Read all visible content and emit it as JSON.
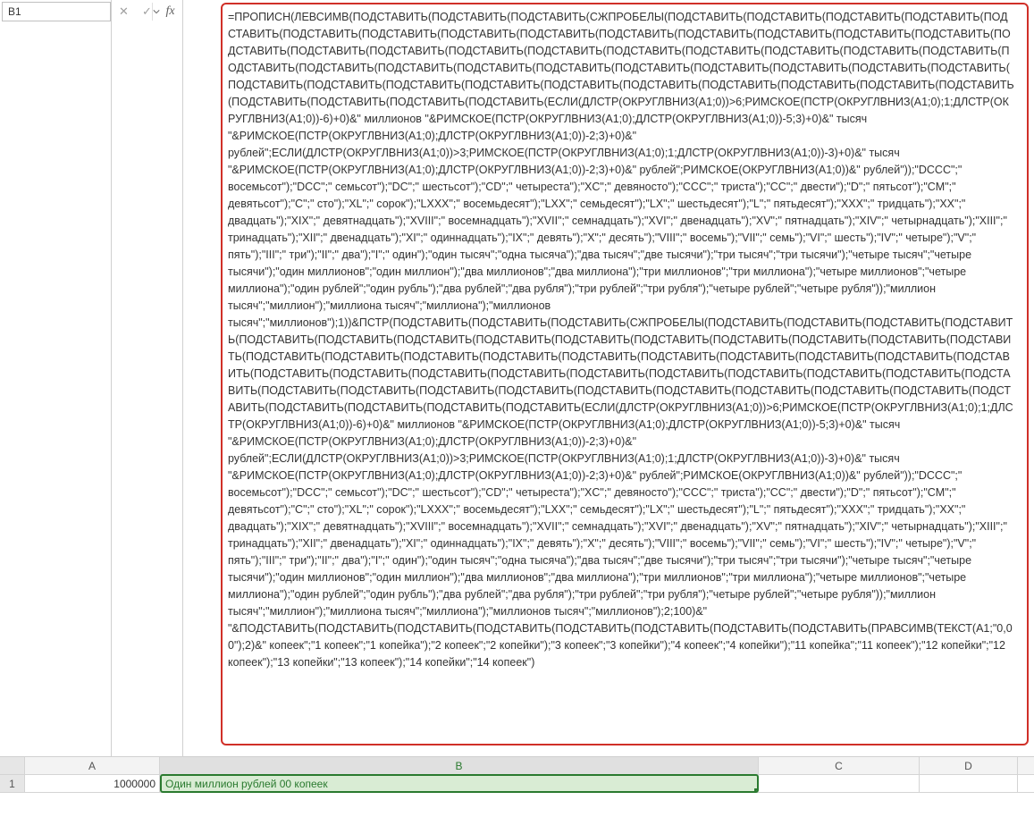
{
  "nameBox": {
    "value": "B1"
  },
  "formulaBarButtons": {
    "cancel": "✕",
    "enter": "✓",
    "fx": "fx"
  },
  "formula": "=ПРОПИСН(ЛЕВСИМВ(ПОДСТАВИТЬ(ПОДСТАВИТЬ(ПОДСТАВИТЬ(СЖПРОБЕЛЫ(ПОДСТАВИТЬ(ПОДСТАВИТЬ(ПОДСТАВИТЬ(ПОДСТАВИТЬ(ПОДСТАВИТЬ(ПОДСТАВИТЬ(ПОДСТАВИТЬ(ПОДСТАВИТЬ(ПОДСТАВИТЬ(ПОДСТАВИТЬ(ПОДСТАВИТЬ(ПОДСТАВИТЬ(ПОДСТАВИТЬ(ПОДСТАВИТЬ(ПОДСТАВИТЬ(ПОДСТАВИТЬ(ПОДСТАВИТЬ(ПОДСТАВИТЬ(ПОДСТАВИТЬ(ПОДСТАВИТЬ(ПОДСТАВИТЬ(ПОДСТАВИТЬ(ПОДСТАВИТЬ(ПОДСТАВИТЬ(ПОДСТАВИТЬ(ПОДСТАВИТЬ(ПОДСТАВИТЬ(ПОДСТАВИТЬ(ПОДСТАВИТЬ(ПОДСТАВИТЬ(ПОДСТАВИТЬ(ПОДСТАВИТЬ(ПОДСТАВИТЬ(ПОДСТАВИТЬ(ПОДСТАВИТЬ(ПОДСТАВИТЬ(ПОДСТАВИТЬ(ПОДСТАВИТЬ(ПОДСТАВИТЬ(ПОДСТАВИТЬ(ПОДСТАВИТЬ(ПОДСТАВИТЬ(ПОДСТАВИТЬ(ПОДСТАВИТЬ(ПОДСТАВИТЬ(ПОДСТАВИТЬ(ПОДСТАВИТЬ(ПОДСТАВИТЬ(ЕСЛИ(ДЛСТР(ОКРУГЛВНИЗ(A1;0))>6;РИМСКОЕ(ПСТР(ОКРУГЛВНИЗ(A1;0);1;ДЛСТР(ОКРУГЛВНИЗ(A1;0))-6)+0)&\" миллионов \"&РИМСКОЕ(ПСТР(ОКРУГЛВНИЗ(A1;0);ДЛСТР(ОКРУГЛВНИЗ(A1;0))-5;3)+0)&\" тысяч \"&РИМСКОЕ(ПСТР(ОКРУГЛВНИЗ(A1;0);ДЛСТР(ОКРУГЛВНИЗ(A1;0))-2;3)+0)&\" рублей\";ЕСЛИ(ДЛСТР(ОКРУГЛВНИЗ(A1;0))>3;РИМСКОЕ(ПСТР(ОКРУГЛВНИЗ(A1;0);1;ДЛСТР(ОКРУГЛВНИЗ(A1;0))-3)+0)&\" тысяч \"&РИМСКОЕ(ПСТР(ОКРУГЛВНИЗ(A1;0);ДЛСТР(ОКРУГЛВНИЗ(A1;0))-2;3)+0)&\" рублей\";РИМСКОЕ(ОКРУГЛВНИЗ(A1;0))&\" рублей\"));\"DCCC\";\" восемьсот\");\"DCC\";\" семьсот\");\"DC\";\" шестьсот\");\"CD\";\" четыреста\");\"XC\";\" девяносто\");\"CCC\";\" триста\");\"CC\";\" двести\");\"D\";\" пятьсот\");\"CM\";\" девятьсот\");\"C\";\" сто\");\"XL\";\" сорок\");\"LXXX\";\" восемьдесят\");\"LXX\";\" семьдесят\");\"LX\";\" шестьдесят\");\"L\";\" пятьдесят\");\"XXX\";\" тридцать\");\"XX\";\" двадцать\");\"XIX\";\" девятнадцать\");\"XVIII\";\" восемнадцать\");\"XVII\";\" семнадцать\");\"XVI\";\" двенадцать\");\"XV\";\" пятнадцать\");\"XIV\";\" четырнадцать\");\"XIII\";\" тринадцать\");\"XII\";\" двенадцать\");\"XI\";\" одиннадцать\");\"IX\";\" девять\");\"X\";\" десять\");\"VIII\";\" восемь\");\"VII\";\" семь\");\"VI\";\" шесть\");\"IV\";\" четыре\");\"V\";\" пять\");\"III\";\" три\");\"II\";\" два\");\"I\";\" один\");\"один тысяч\";\"одна тысяча\");\"два тысяч\";\"две тысячи\");\"три тысяч\";\"три тысячи\");\"четыре тысяч\";\"четыре тысячи\");\"один миллионов\";\"один миллион\");\"два миллионов\";\"два миллиона\");\"три миллионов\";\"три миллиона\");\"четыре миллионов\";\"четыре миллиона\");\"один рублей\";\"один рубль\");\"два рублей\";\"два рубля\");\"три рублей\";\"три рубля\");\"четыре рублей\";\"четыре рубля\"));\"миллион тысяч\";\"миллион\");\"миллиона тысяч\";\"миллиона\");\"миллионов тысяч\";\"миллионов\");1))&ПСТР(ПОДСТАВИТЬ(ПОДСТАВИТЬ(ПОДСТАВИТЬ(СЖПРОБЕЛЫ(ПОДСТАВИТЬ(ПОДСТАВИТЬ(ПОДСТАВИТЬ(ПОДСТАВИТЬ(ПОДСТАВИТЬ(ПОДСТАВИТЬ(ПОДСТАВИТЬ(ПОДСТАВИТЬ(ПОДСТАВИТЬ(ПОДСТАВИТЬ(ПОДСТАВИТЬ(ПОДСТАВИТЬ(ПОДСТАВИТЬ(ПОДСТАВИТЬ(ПОДСТАВИТЬ(ПОДСТАВИТЬ(ПОДСТАВИТЬ(ПОДСТАВИТЬ(ПОДСТАВИТЬ(ПОДСТАВИТЬ(ПОДСТАВИТЬ(ПОДСТАВИТЬ(ПОДСТАВИТЬ(ПОДСТАВИТЬ(ПОДСТАВИТЬ(ПОДСТАВИТЬ(ПОДСТАВИТЬ(ПОДСТАВИТЬ(ПОДСТАВИТЬ(ПОДСТАВИТЬ(ПОДСТАВИТЬ(ПОДСТАВИТЬ(ПОДСТАВИТЬ(ПОДСТАВИТЬ(ПОДСТАВИТЬ(ПОДСТАВИТЬ(ПОДСТАВИТЬ(ПОДСТАВИТЬ(ПОДСТАВИТЬ(ПОДСТАВИТЬ(ПОДСТАВИТЬ(ПОДСТАВИТЬ(ПОДСТАВИТЬ(ПОДСТАВИТЬ(ПОДСТАВИТЬ(ПОДСТАВИТЬ(ПОДСТАВИТЬ(ПОДСТАВИТЬ(ЕСЛИ(ДЛСТР(ОКРУГЛВНИЗ(A1;0))>6;РИМСКОЕ(ПСТР(ОКРУГЛВНИЗ(A1;0);1;ДЛСТР(ОКРУГЛВНИЗ(A1;0))-6)+0)&\" миллионов \"&РИМСКОЕ(ПСТР(ОКРУГЛВНИЗ(A1;0);ДЛСТР(ОКРУГЛВНИЗ(A1;0))-5;3)+0)&\" тысяч \"&РИМСКОЕ(ПСТР(ОКРУГЛВНИЗ(A1;0);ДЛСТР(ОКРУГЛВНИЗ(A1;0))-2;3)+0)&\" рублей\";ЕСЛИ(ДЛСТР(ОКРУГЛВНИЗ(A1;0))>3;РИМСКОЕ(ПСТР(ОКРУГЛВНИЗ(A1;0);1;ДЛСТР(ОКРУГЛВНИЗ(A1;0))-3)+0)&\" тысяч \"&РИМСКОЕ(ПСТР(ОКРУГЛВНИЗ(A1;0);ДЛСТР(ОКРУГЛВНИЗ(A1;0))-2;3)+0)&\" рублей\";РИМСКОЕ(ОКРУГЛВНИЗ(A1;0))&\" рублей\"));\"DCCC\";\" восемьсот\");\"DCC\";\" семьсот\");\"DC\";\" шестьсот\");\"CD\";\" четыреста\");\"XC\";\" девяносто\");\"CCC\";\" триста\");\"CC\";\" двести\");\"D\";\" пятьсот\");\"CM\";\" девятьсот\");\"C\";\" сто\");\"XL\";\" сорок\");\"LXXX\";\" восемьдесят\");\"LXX\";\" семьдесят\");\"LX\";\" шестьдесят\");\"L\";\" пятьдесят\");\"XXX\";\" тридцать\");\"XX\";\" двадцать\");\"XIX\";\" девятнадцать\");\"XVIII\";\" восемнадцать\");\"XVII\";\" семнадцать\");\"XVI\";\" двенадцать\");\"XV\";\" пятнадцать\");\"XIV\";\" четырнадцать\");\"XIII\";\" тринадцать\");\"XII\";\" двенадцать\");\"XI\";\" одиннадцать\");\"IX\";\" девять\");\"X\";\" десять\");\"VIII\";\" восемь\");\"VII\";\" семь\");\"VI\";\" шесть\");\"IV\";\" четыре\");\"V\";\" пять\");\"III\";\" три\");\"II\";\" два\");\"I\";\" один\");\"один тысяч\";\"одна тысяча\");\"два тысяч\";\"две тысячи\");\"три тысяч\";\"три тысячи\");\"четыре тысяч\";\"четыре тысячи\");\"один миллионов\";\"один миллион\");\"два миллионов\";\"два миллиона\");\"три миллионов\";\"три миллиона\");\"четыре миллионов\";\"четыре миллиона\");\"один рублей\";\"один рубль\");\"два рублей\";\"два рубля\");\"три рублей\";\"три рубля\");\"четыре рублей\";\"четыре рубля\"));\"миллион тысяч\";\"миллион\");\"миллиона тысяч\";\"миллиона\");\"миллионов тысяч\";\"миллионов\");2;100)&\" \"&ПОДСТАВИТЬ(ПОДСТАВИТЬ(ПОДСТАВИТЬ(ПОДСТАВИТЬ(ПОДСТАВИТЬ(ПОДСТАВИТЬ(ПОДСТАВИТЬ(ПОДСТАВИТЬ(ПРАВСИМВ(ТЕКСТ(A1;\"0,00\");2)&\" копеек\";\"1 копеек\";\"1 копейка\");\"2 копеек\";\"2 копейки\");\"3 копеек\";\"3 копейки\");\"4 копеек\";\"4 копейки\");\"11 копейка\";\"11 копеек\");\"12 копейки\";\"12 копеек\");\"13 копейки\";\"13 копеек\");\"14 копейки\";\"14 копеек\")",
  "columns": [
    "A",
    "B",
    "C",
    "D"
  ],
  "rows": [
    {
      "n": "1",
      "cells": {
        "A": "1000000",
        "B": "Один миллион рублей 00 копеек",
        "C": "",
        "D": ""
      }
    }
  ],
  "selectedCell": "B1"
}
